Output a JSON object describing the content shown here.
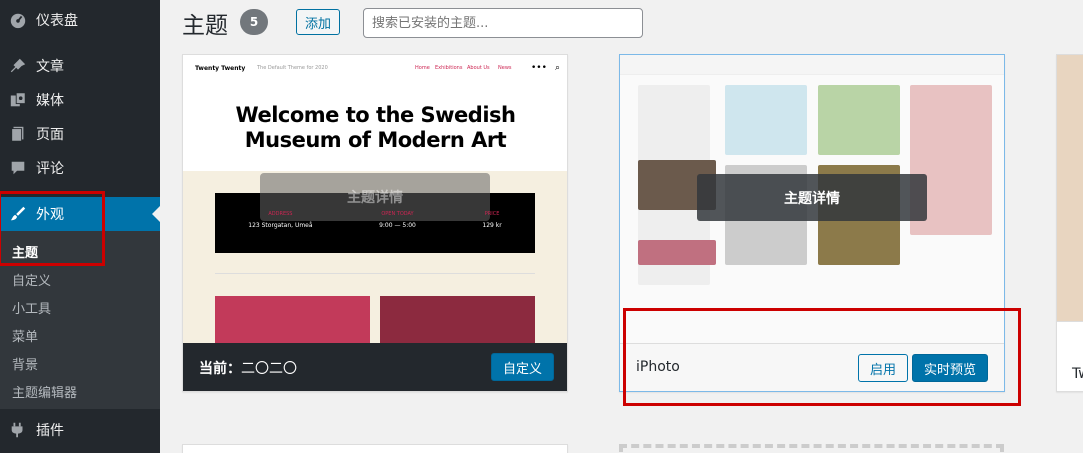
{
  "sidebar": {
    "items": [
      {
        "label": "仪表盘",
        "icon": "dashboard-icon"
      },
      {
        "label": "文章",
        "icon": "pin-icon"
      },
      {
        "label": "媒体",
        "icon": "media-icon"
      },
      {
        "label": "页面",
        "icon": "page-icon"
      },
      {
        "label": "评论",
        "icon": "comment-icon"
      },
      {
        "label": "外观",
        "icon": "brush-icon"
      },
      {
        "label": "插件",
        "icon": "plugin-icon"
      }
    ],
    "submenu": [
      "主题",
      "自定义",
      "小工具",
      "菜单",
      "背景",
      "主题编辑器"
    ]
  },
  "header": {
    "title": "主题",
    "count": "5",
    "add_label": "添加",
    "search_placeholder": "搜索已安装的主题..."
  },
  "cards": {
    "active": {
      "footer_prefix": "当前：",
      "name": "二〇二〇",
      "customize_label": "自定义",
      "overlay_label": "主题详情",
      "preview": {
        "site_title": "Twenty Twenty",
        "tagline": "The Default Theme for 2020",
        "nav": [
          "Home",
          "Exhibitions",
          "About Us",
          "News"
        ],
        "hero_line1": "Welcome to the Swedish",
        "hero_line2": "Museum of Modern Art",
        "cols": [
          {
            "label": "ADDRESS",
            "value": "123 Storgatan, Umeå"
          },
          {
            "label": "OPEN TODAY",
            "value": "9:00 — 5:00"
          },
          {
            "label": "PRICE",
            "value": "129 kr"
          }
        ]
      }
    },
    "iphoto": {
      "name": "iPhoto",
      "activate_label": "启用",
      "preview_label": "实时预览",
      "overlay_label": "主题详情"
    },
    "partial": {
      "name_fragment": "Tw"
    }
  }
}
